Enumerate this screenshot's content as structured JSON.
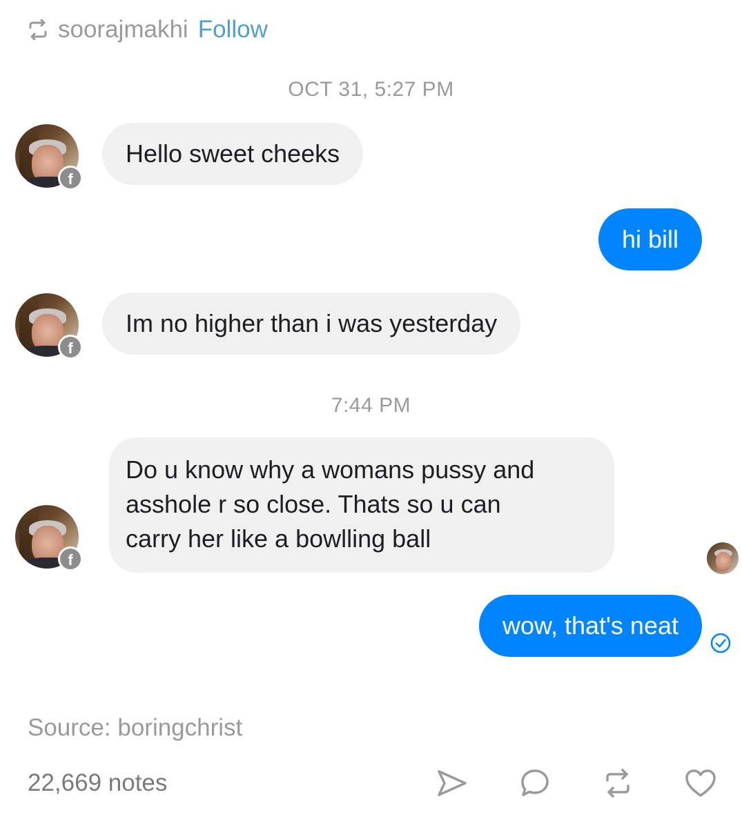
{
  "post": {
    "reblogged_from": "soorajmakhi",
    "follow_label": "Follow",
    "source_label": "Source:",
    "source_value": "boringchrist",
    "notes": "22,669 notes"
  },
  "chat": {
    "timestamps": [
      "OCT 31, 5:27 PM",
      "7:44 PM"
    ],
    "messages": [
      {
        "from": "bill",
        "text": "Hello sweet cheeks"
      },
      {
        "from": "me",
        "text": "hi bill"
      },
      {
        "from": "bill",
        "text": "Im no higher than i was yesterday"
      },
      {
        "from": "bill",
        "lines": [
          "Do u know why a womans pussy and",
          "asshole r so close. Thats so u can",
          "carry her like a bowlling ball"
        ]
      },
      {
        "from": "me",
        "text": "wow, that's neat"
      }
    ],
    "badge_glyph": "f"
  },
  "icons": {
    "reblog": "reblog-icon",
    "share": "send-icon",
    "reply": "speech-bubble-icon",
    "reblog_action": "reblog-icon",
    "like": "heart-icon",
    "sent": "check-circle-icon",
    "facebook": "facebook-badge-icon"
  },
  "colors": {
    "follow": "#529ecc",
    "bubble_in": "#f1f0f0",
    "bubble_out": "#0084ff",
    "muted_text": "#9a9a9a",
    "icon_gray": "#9a9a9a"
  }
}
